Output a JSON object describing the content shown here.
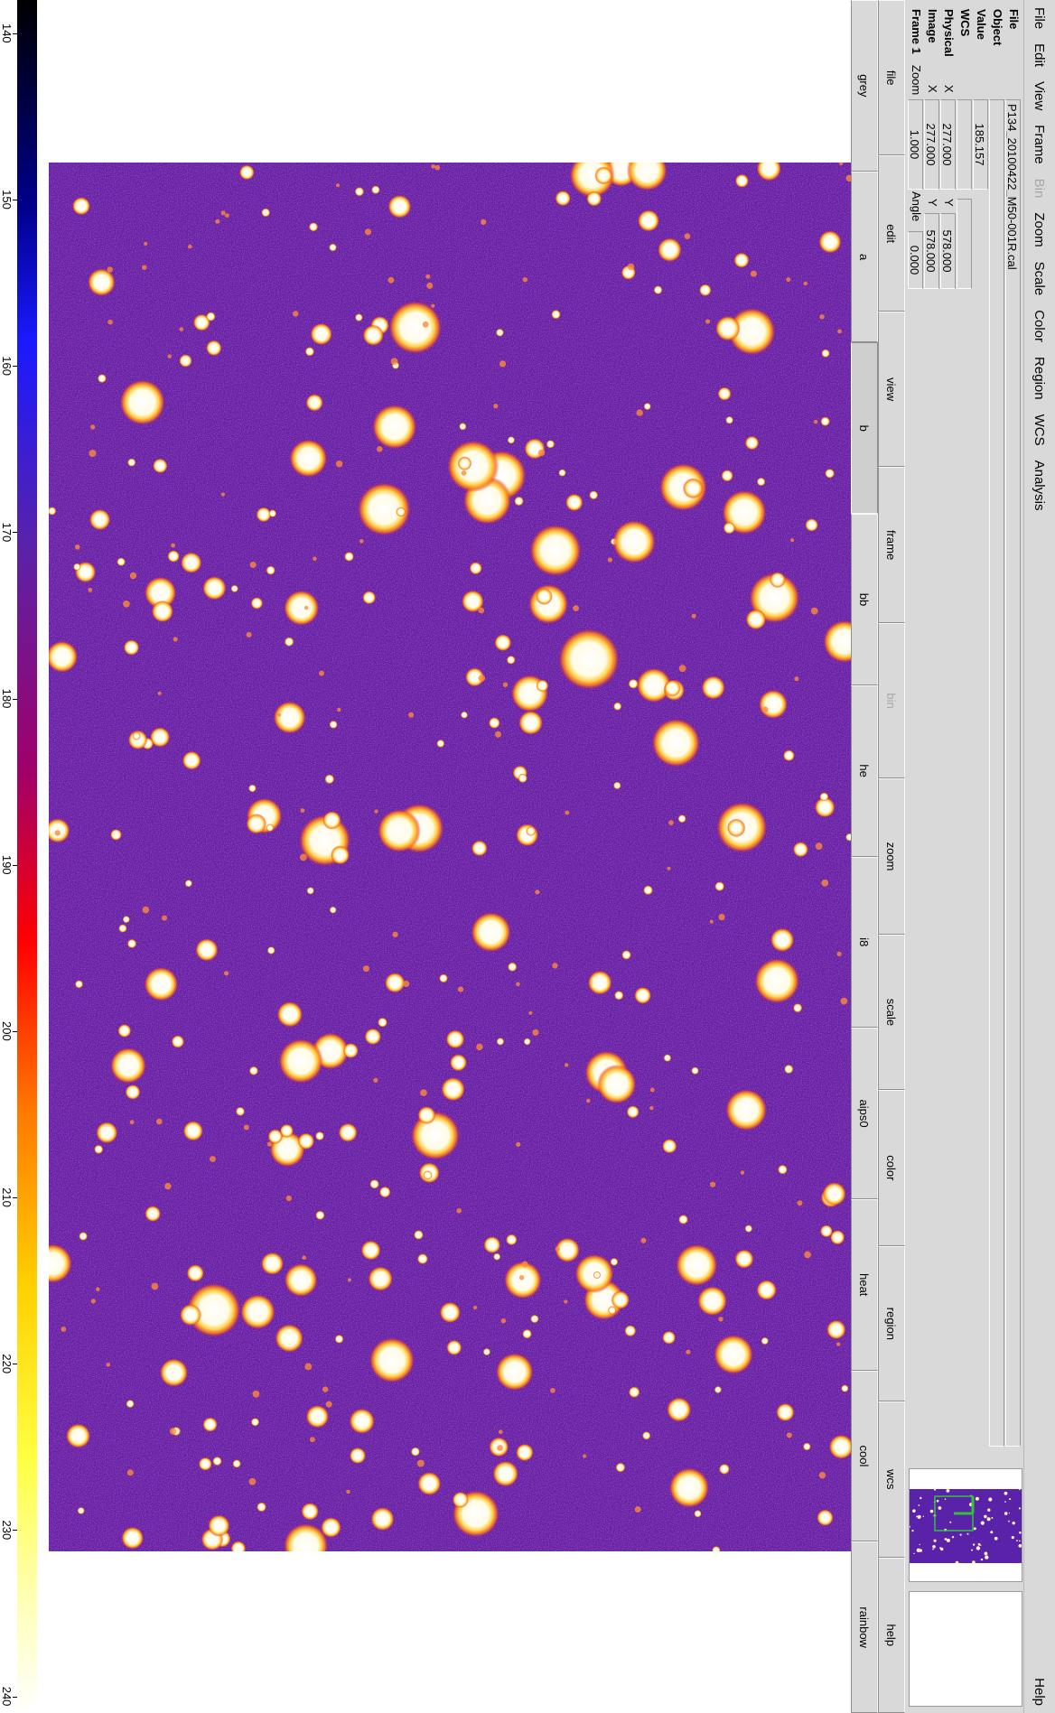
{
  "menu": {
    "items": [
      {
        "label": "File",
        "enabled": true
      },
      {
        "label": "Edit",
        "enabled": true
      },
      {
        "label": "View",
        "enabled": true
      },
      {
        "label": "Frame",
        "enabled": true
      },
      {
        "label": "Bin",
        "enabled": false
      },
      {
        "label": "Zoom",
        "enabled": true
      },
      {
        "label": "Scale",
        "enabled": true
      },
      {
        "label": "Color",
        "enabled": true
      },
      {
        "label": "Region",
        "enabled": true
      },
      {
        "label": "WCS",
        "enabled": true
      },
      {
        "label": "Analysis",
        "enabled": true
      }
    ],
    "help": "Help"
  },
  "info": {
    "file_label": "File",
    "file_value": "P134_20100422_M50-001R.cal",
    "object_label": "Object",
    "object_value": "",
    "value_label": "Value",
    "value_value": "185.157",
    "wcs_label": "WCS",
    "physical_label": "Physical",
    "image_label": "Image",
    "frame_label": "Frame 1",
    "x_label": "X",
    "y_label": "Y",
    "zoom_label": "Zoom",
    "angle_label": "Angle",
    "physical_x": "277.000",
    "physical_y": "578.000",
    "image_x": "277.000",
    "image_y": "578.000",
    "zoom_value": "1.000",
    "angle_value": "0.000"
  },
  "buttonbar_top": [
    "file",
    "edit",
    "view",
    "frame",
    "bin",
    "zoom",
    "scale",
    "color",
    "region",
    "wcs",
    "help"
  ],
  "buttonbar_top_disabled": "bin",
  "buttonbar_bottom": [
    "grey",
    "a",
    "b",
    "bb",
    "he",
    "i8",
    "aips0",
    "heat",
    "cool",
    "rainbow"
  ],
  "buttonbar_bottom_active": "b",
  "colorbar": {
    "colormap": "b",
    "min": 138,
    "max": 241,
    "ticks": [
      140,
      150,
      160,
      170,
      180,
      190,
      200,
      210,
      220,
      230,
      240
    ]
  },
  "colors": {
    "background_sky": "#5a22a8",
    "star_core": "#fffbe6",
    "star_halo": "#ff9a1a",
    "chrome": "#d9d9d9"
  }
}
